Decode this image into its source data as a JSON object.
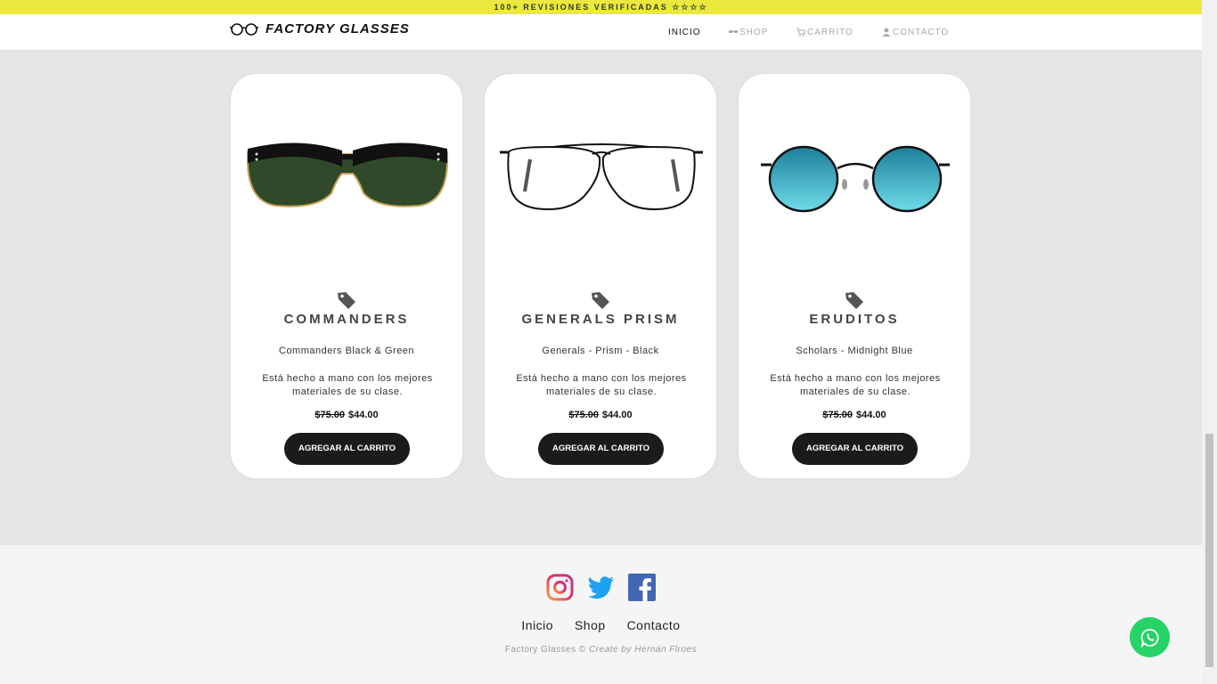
{
  "announcement": "100+ REVISIONES VERIFICADAS ☆☆☆☆",
  "brand": {
    "name": "FACTORY GLASSES"
  },
  "nav": {
    "items": [
      {
        "label": "INICIO",
        "icon": ""
      },
      {
        "label": "SHOP",
        "icon": "glasses-icon"
      },
      {
        "label": "CARRITO",
        "icon": "cart-icon"
      },
      {
        "label": "CONTACTO",
        "icon": "contact-icon"
      }
    ]
  },
  "products": [
    {
      "title": "COMMANDERS",
      "subtitle": "Commanders Black & Green",
      "description": "Está hecho a mano con los mejores materiales de su clase.",
      "old_price": "$75.00",
      "price": "$44.00",
      "button": "AGREGAR AL CARRITO",
      "lens_color": "#2f4a2a",
      "frame_color": "#111111"
    },
    {
      "title": "GENERALS PRISM",
      "subtitle": "Generals - Prism - Black",
      "description": "Está hecho a mano con los mejores materiales de su clase.",
      "old_price": "$75.00",
      "price": "$44.00",
      "button": "AGREGAR AL CARRITO",
      "lens_color": "#ffffff",
      "frame_color": "#111111"
    },
    {
      "title": "ERUDITOS",
      "subtitle": "Scholars - Midnight Blue",
      "description": "Está hecho a mano con los mejores materiales de su clase.",
      "old_price": "$75.00",
      "price": "$44.00",
      "button": "AGREGAR AL CARRITO",
      "lens_color": "#2aa6c4",
      "frame_color": "#111111"
    }
  ],
  "footer": {
    "socials": [
      "instagram-icon",
      "twitter-icon",
      "facebook-icon"
    ],
    "links": [
      "Inicio",
      "Shop",
      "Contacto"
    ],
    "copyright_brand": "Factory Glasses ©",
    "copyright_author": "Create by Hernán Flroes"
  },
  "colors": {
    "announcement_bg": "#ebe83e",
    "button_bg": "#1b1b1b",
    "whatsapp": "#25d366"
  }
}
